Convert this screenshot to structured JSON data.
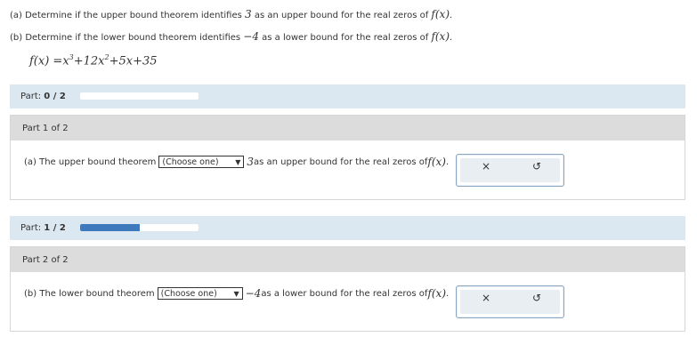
{
  "questions": {
    "a": {
      "prefix": "(a) Determine if the upper bound theorem identifies ",
      "num": "3",
      "middle": " as an upper bound for the real zeros of ",
      "fx": "f(x)",
      "end": "."
    },
    "b": {
      "prefix": "(b) Determine if the lower bound theorem identifies ",
      "num": "−4",
      "middle": " as a lower bound for the real zeros of ",
      "fx": "f(x)",
      "end": "."
    }
  },
  "function": {
    "lhs": "f(x) =",
    "x": "x",
    "e1": "3",
    "t2": "+12x",
    "e2": "2",
    "t3": "+5x+35"
  },
  "part_bars": [
    {
      "label": "Part: ",
      "progress": "0 / 2",
      "fraction": 0
    },
    {
      "label": "Part: ",
      "progress": "1 / 2",
      "fraction": 0.5
    }
  ],
  "parts": [
    {
      "title": "Part 1 of 2",
      "prefix": "(a) The upper bound theorem",
      "select": "(Choose one)",
      "num": "3",
      "suffix": " as an upper bound for the real zeros of ",
      "fx": "f(x)",
      "end": "."
    },
    {
      "title": "Part 2 of 2",
      "prefix": "(b) The lower bound theorem",
      "select": "(Choose one)",
      "num": "−4",
      "suffix": " as a lower bound for the real zeros of ",
      "fx": "f(x)",
      "end": "."
    }
  ],
  "icons": {
    "clear": "×",
    "reset": "↺"
  }
}
